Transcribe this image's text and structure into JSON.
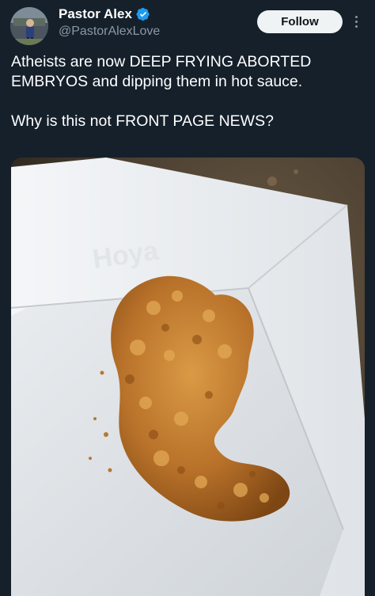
{
  "author": {
    "display_name": "Pastor Alex",
    "handle": "@PastorAlexLove",
    "verified": true,
    "verified_color": "#1d9bf0"
  },
  "actions": {
    "follow_label": "Follow",
    "more_icon": "more-vertical-icon"
  },
  "tweet": {
    "line1": "Atheists are now DEEP FRYING ABORTED EMBRYOS and dipping them in hot sauce.",
    "line2": "Why is this not FRONT PAGE NEWS?"
  },
  "media": {
    "content": "photo of a fried chicken tender in a white paper tray"
  },
  "colors": {
    "background": "#15202b",
    "text": "#ffffff",
    "secondary_text": "#8b98a5",
    "button_bg": "#eff3f4",
    "button_text": "#0f1419"
  }
}
